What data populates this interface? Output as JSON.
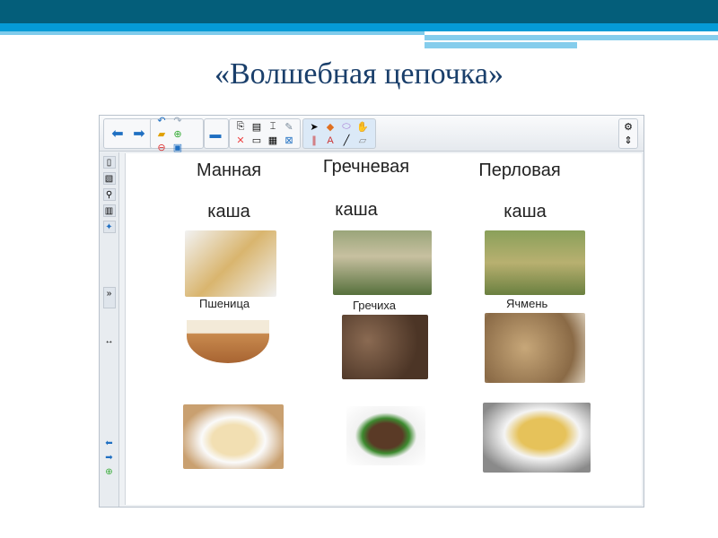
{
  "title": "«Волшебная цепочка»",
  "columns": [
    {
      "heading": "Манная",
      "heading2": "каша",
      "grain": "Пшеница"
    },
    {
      "heading": "Гречневая",
      "heading2": "каша",
      "grain": "Гречиха"
    },
    {
      "heading": "Перловая",
      "heading2": "каша",
      "grain": "Ячмень"
    }
  ],
  "toolbar": {
    "icons": [
      "back",
      "forward",
      "undo",
      "redo",
      "open",
      "add-page",
      "delete-page",
      "save",
      "screen-shade",
      "paste",
      "clear",
      "table-tools",
      "insert",
      "delete",
      "display",
      "table",
      "fill",
      "select",
      "pen",
      "eraser",
      "magic",
      "pens",
      "text",
      "line",
      "shapes"
    ]
  },
  "settings": {
    "gear": "⚙",
    "arrows": "⇕"
  },
  "colors": {
    "band_dark": "#045e7a",
    "band_blue": "#059bd6",
    "title": "#1a3f6b"
  }
}
